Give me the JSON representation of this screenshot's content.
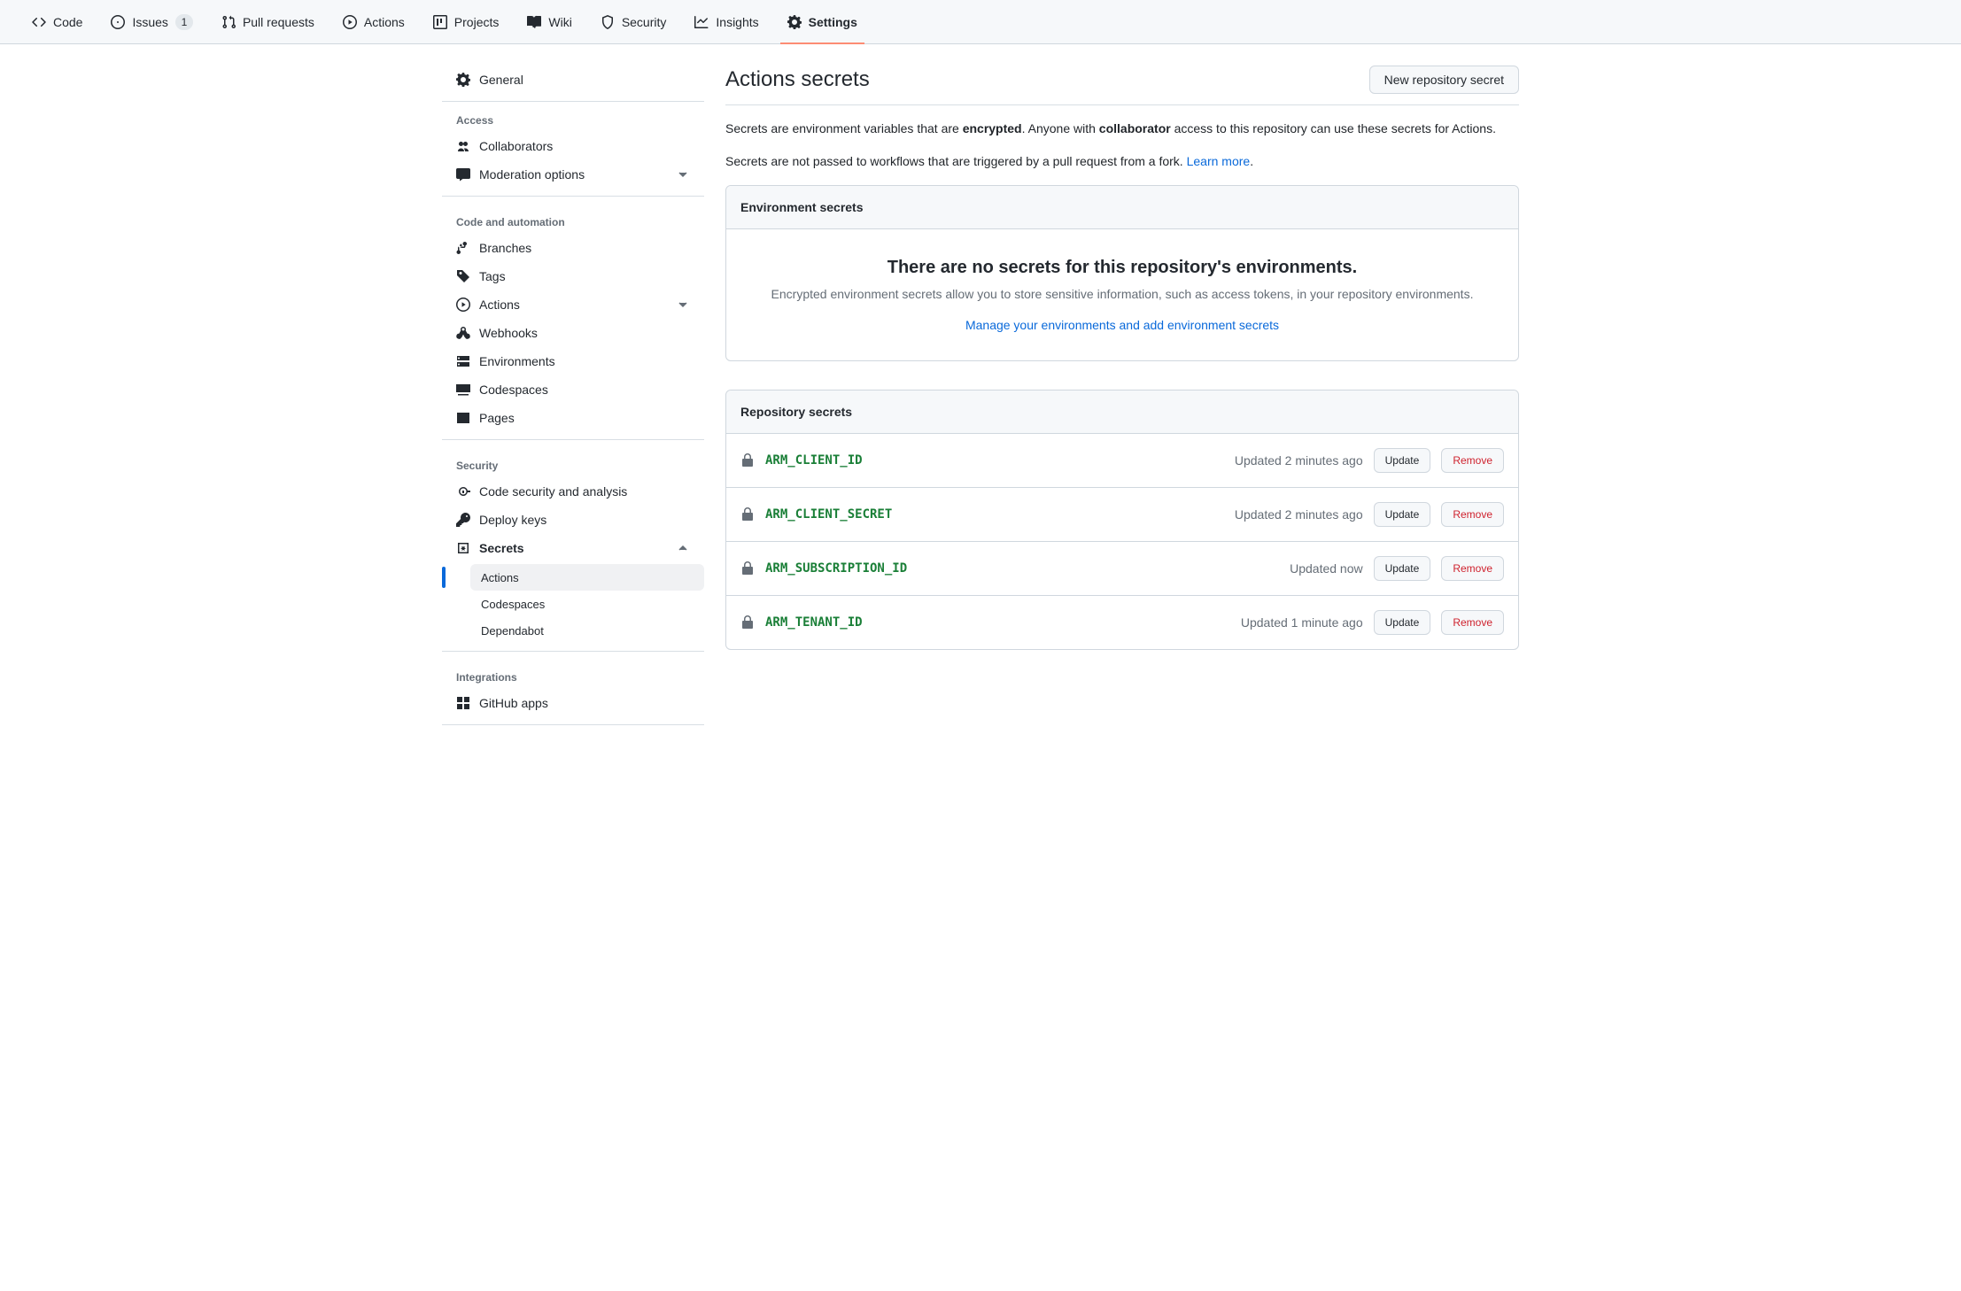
{
  "topnav": {
    "items": [
      {
        "label": "Code",
        "icon": "code"
      },
      {
        "label": "Issues",
        "icon": "issue",
        "count": "1"
      },
      {
        "label": "Pull requests",
        "icon": "pr"
      },
      {
        "label": "Actions",
        "icon": "play"
      },
      {
        "label": "Projects",
        "icon": "project"
      },
      {
        "label": "Wiki",
        "icon": "book"
      },
      {
        "label": "Security",
        "icon": "shield"
      },
      {
        "label": "Insights",
        "icon": "graph"
      },
      {
        "label": "Settings",
        "icon": "gear",
        "active": true
      }
    ]
  },
  "sidebar": {
    "general": "General",
    "groups": [
      {
        "heading": "Access",
        "items": [
          {
            "label": "Collaborators",
            "icon": "people"
          },
          {
            "label": "Moderation options",
            "icon": "comment",
            "expandable": true
          }
        ]
      },
      {
        "heading": "Code and automation",
        "items": [
          {
            "label": "Branches",
            "icon": "branch"
          },
          {
            "label": "Tags",
            "icon": "tag"
          },
          {
            "label": "Actions",
            "icon": "play",
            "expandable": true
          },
          {
            "label": "Webhooks",
            "icon": "webhook"
          },
          {
            "label": "Environments",
            "icon": "server"
          },
          {
            "label": "Codespaces",
            "icon": "codespace"
          },
          {
            "label": "Pages",
            "icon": "browser"
          }
        ]
      },
      {
        "heading": "Security",
        "items": [
          {
            "label": "Code security and analysis",
            "icon": "scan"
          },
          {
            "label": "Deploy keys",
            "icon": "key"
          },
          {
            "label": "Secrets",
            "icon": "asterisk",
            "expanded": true,
            "bold": true,
            "children": [
              {
                "label": "Actions",
                "active": true
              },
              {
                "label": "Codespaces"
              },
              {
                "label": "Dependabot"
              }
            ]
          }
        ]
      },
      {
        "heading": "Integrations",
        "items": [
          {
            "label": "GitHub apps",
            "icon": "apps"
          }
        ]
      }
    ]
  },
  "page": {
    "title": "Actions secrets",
    "new_button": "New repository secret",
    "desc1_pre": "Secrets are environment variables that are ",
    "desc1_b1": "encrypted",
    "desc1_mid": ". Anyone with ",
    "desc1_b2": "collaborator",
    "desc1_post": " access to this repository can use these secrets for Actions.",
    "desc2": "Secrets are not passed to workflows that are triggered by a pull request from a fork. ",
    "learn_more": "Learn more",
    "dot": "."
  },
  "env_panel": {
    "header": "Environment secrets",
    "empty_title": "There are no secrets for this repository's environments.",
    "empty_desc": "Encrypted environment secrets allow you to store sensitive information, such as access tokens, in your repository environments.",
    "manage_link": "Manage your environments and add environment secrets"
  },
  "repo_panel": {
    "header": "Repository secrets",
    "update_label": "Update",
    "remove_label": "Remove",
    "secrets": [
      {
        "name": "ARM_CLIENT_ID",
        "updated": "Updated 2 minutes ago"
      },
      {
        "name": "ARM_CLIENT_SECRET",
        "updated": "Updated 2 minutes ago"
      },
      {
        "name": "ARM_SUBSCRIPTION_ID",
        "updated": "Updated now"
      },
      {
        "name": "ARM_TENANT_ID",
        "updated": "Updated 1 minute ago"
      }
    ]
  }
}
